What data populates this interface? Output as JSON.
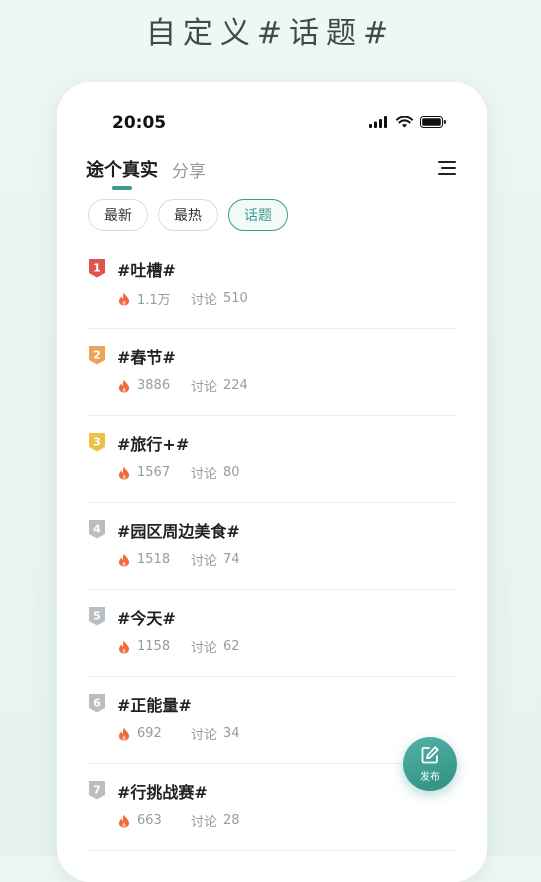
{
  "headline": "自定义#话题#",
  "status": {
    "time": "20:05"
  },
  "nav": {
    "tabs": [
      {
        "label": "途个真实"
      },
      {
        "label": "分享"
      }
    ]
  },
  "filters": [
    {
      "label": "最新",
      "selected": false
    },
    {
      "label": "最热",
      "selected": false
    },
    {
      "label": "话题",
      "selected": true
    }
  ],
  "topics": [
    {
      "rank": "1",
      "title": "#吐槽#",
      "heat": "1.1万",
      "discuss_label": "讨论",
      "discuss_count": "510"
    },
    {
      "rank": "2",
      "title": "#春节#",
      "heat": "3886",
      "discuss_label": "讨论",
      "discuss_count": "224"
    },
    {
      "rank": "3",
      "title": "#旅行+#",
      "heat": "1567",
      "discuss_label": "讨论",
      "discuss_count": "80"
    },
    {
      "rank": "4",
      "title": "#园区周边美食#",
      "heat": "1518",
      "discuss_label": "讨论",
      "discuss_count": "74"
    },
    {
      "rank": "5",
      "title": "#今天#",
      "heat": "1158",
      "discuss_label": "讨论",
      "discuss_count": "62"
    },
    {
      "rank": "6",
      "title": "#正能量#",
      "heat": "692",
      "discuss_label": "讨论",
      "discuss_count": "34"
    },
    {
      "rank": "7",
      "title": "#行挑战赛#",
      "heat": "663",
      "discuss_label": "讨论",
      "discuss_count": "28"
    }
  ],
  "fab": {
    "label": "发布"
  },
  "colors": {
    "accent": "#3a9b8f",
    "rank1": "#e0544d",
    "rank2": "#efa35a",
    "rank3": "#edc04a",
    "rank_other": "#b9bec2",
    "flame": "#f06a3c"
  },
  "icons": {
    "menu": "menu-icon",
    "flame": "flame-icon",
    "fab": "edit-icon"
  }
}
